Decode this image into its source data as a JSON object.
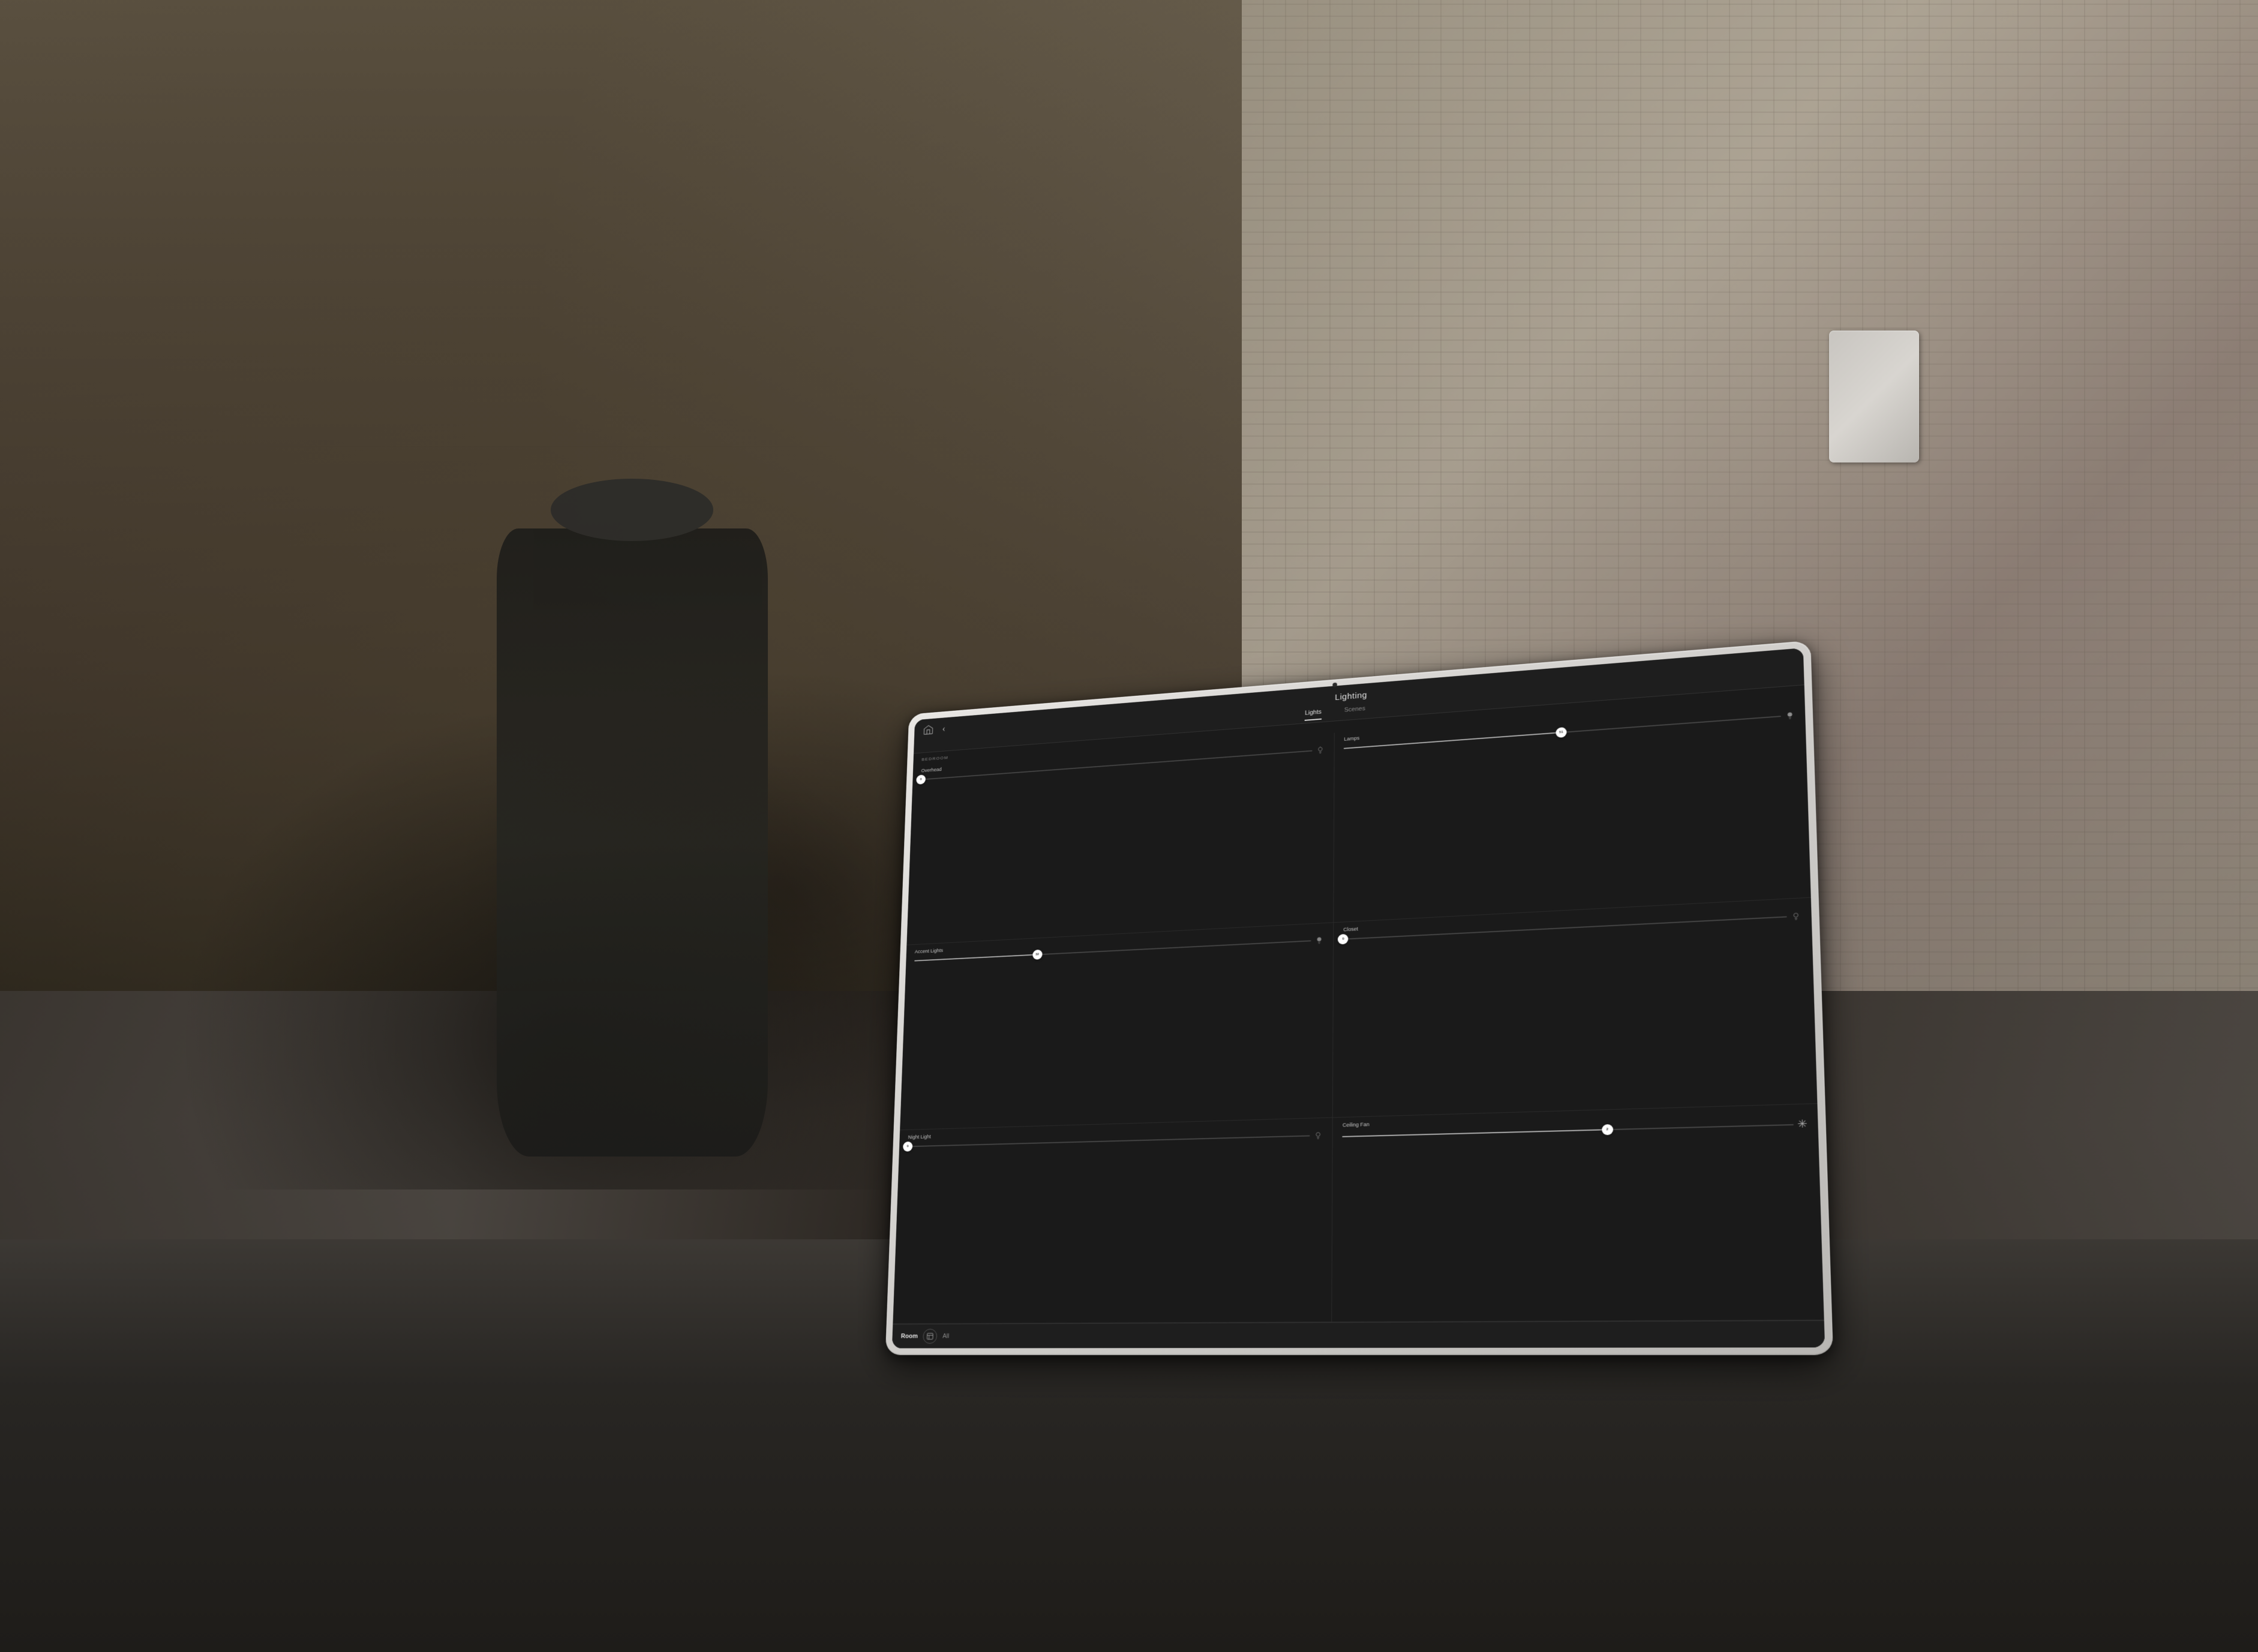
{
  "scene": {
    "background": "kitchen counter with coffee items"
  },
  "tablet": {
    "camera_dot": true
  },
  "app": {
    "title": "Lighting",
    "tabs": [
      {
        "label": "Lights",
        "active": true
      },
      {
        "label": "Scenes",
        "active": false
      }
    ],
    "section_label": "BEDROOM",
    "controls": [
      {
        "label": "Overhead",
        "value": 0,
        "percent": 0,
        "icon": "bulb",
        "side": "left"
      },
      {
        "label": "Lamps",
        "value": 51,
        "percent": 51,
        "icon": "bulb",
        "side": "right"
      },
      {
        "label": "Accent Lights",
        "value": 32,
        "percent": 32,
        "icon": "bulb",
        "side": "left"
      },
      {
        "label": "Closet",
        "value": 0,
        "percent": 0,
        "icon": "bulb",
        "side": "right"
      },
      {
        "label": "Night Light",
        "value": 0,
        "percent": 0,
        "icon": "bulb",
        "side": "left"
      },
      {
        "label": "Ceiling Fan",
        "value": 2,
        "percent": 60,
        "icon": "fan",
        "side": "right"
      }
    ],
    "footer": {
      "room_label": "Room",
      "all_label": "All"
    }
  }
}
